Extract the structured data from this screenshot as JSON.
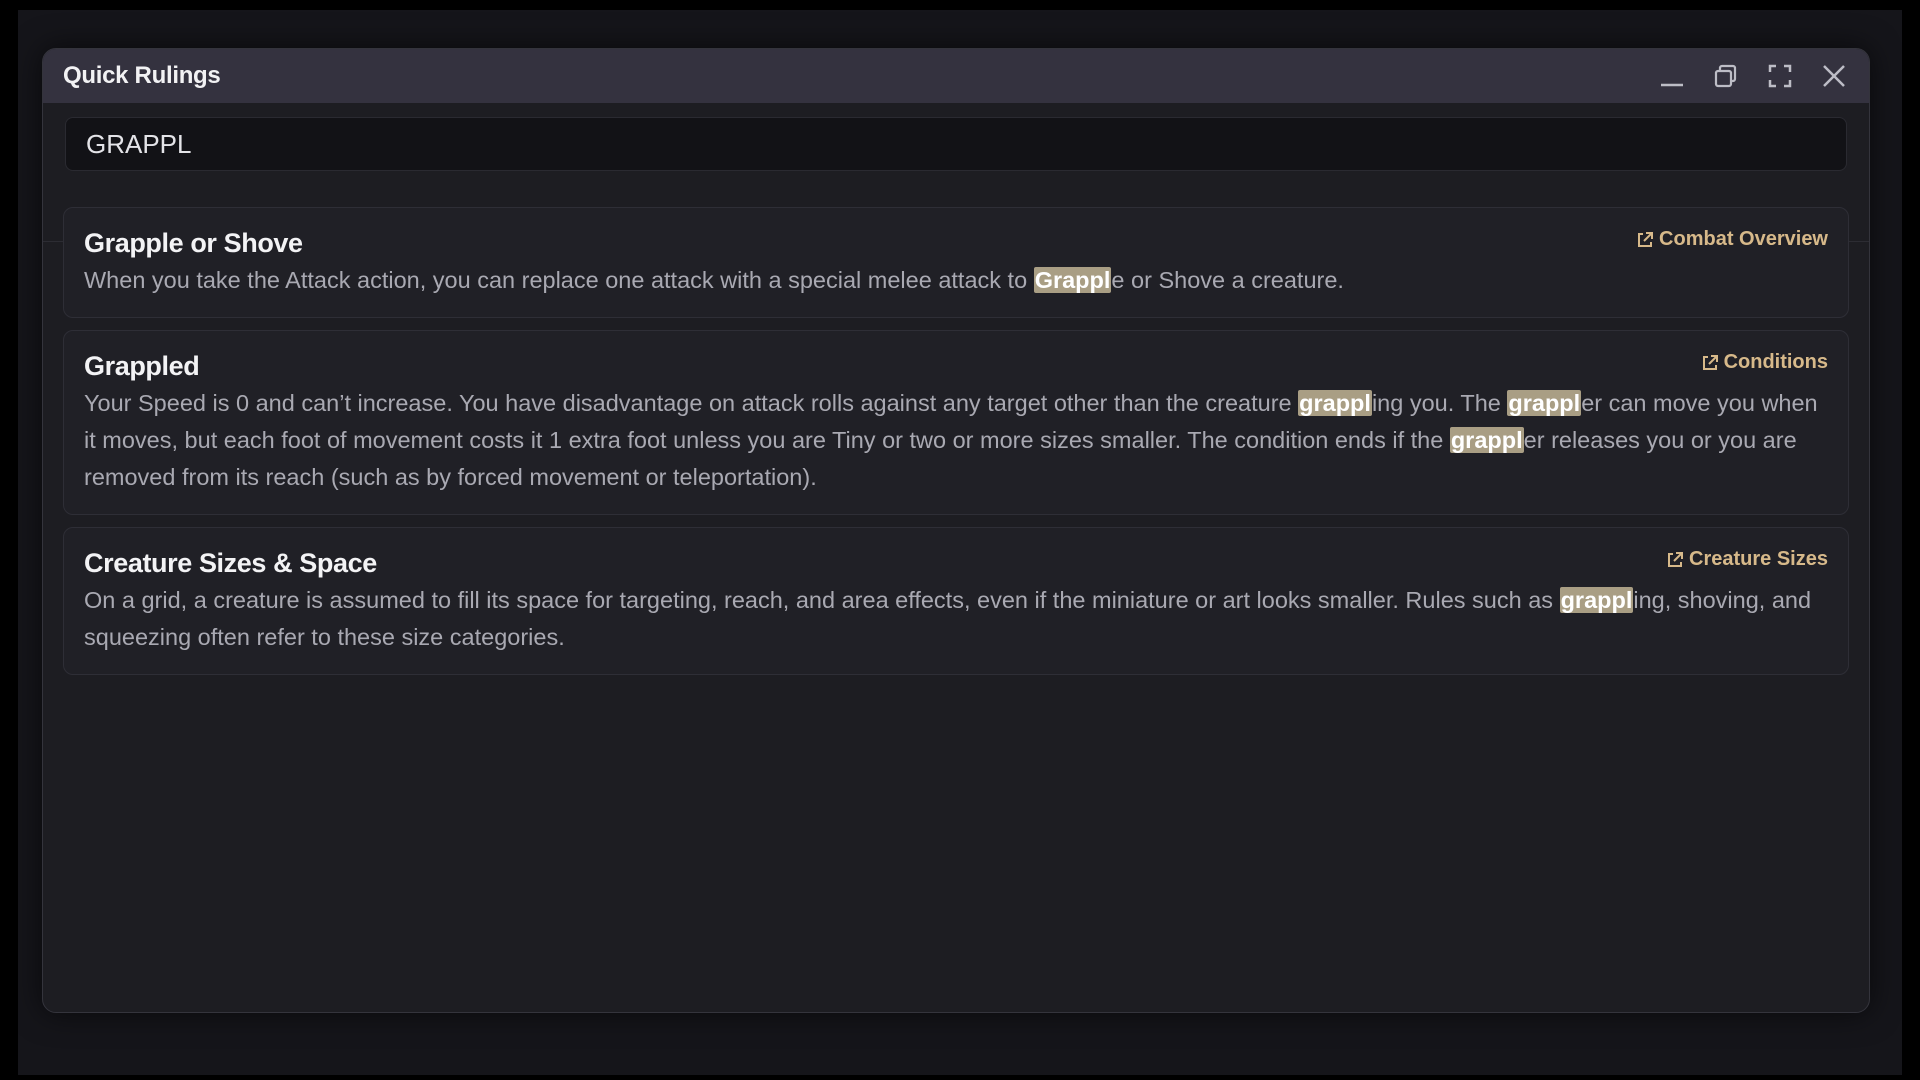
{
  "window": {
    "title": "Quick Rulings",
    "controls": [
      "minimize-icon",
      "restore-icon",
      "fullscreen-icon",
      "close-icon"
    ]
  },
  "search": {
    "value": "GRAPPL",
    "placeholder": ""
  },
  "colors": {
    "titlebar": "#34323f",
    "window_bg": "#1d1d22",
    "card_bg": "#202026",
    "link_accent": "#d7b98a",
    "highlight": "#a99e84",
    "body_text": "#a9a9b2"
  },
  "results": [
    {
      "title": "Grapple or Shove",
      "link_icon": "external-link-icon",
      "link_label": "Combat Overview",
      "segments": [
        {
          "text": "When you take the Attack action, you can replace one attack with a special melee attack to "
        },
        {
          "text": "Grappl",
          "hl": true
        },
        {
          "text": "e or Shove a creature."
        }
      ]
    },
    {
      "title": "Grappled",
      "link_icon": "external-link-icon",
      "link_label": "Conditions",
      "segments": [
        {
          "text": "Your Speed is 0 and can’t increase. You have disadvantage on attack rolls against any target other than the creature "
        },
        {
          "text": "grappl",
          "hl": true
        },
        {
          "text": "ing you. The "
        },
        {
          "text": "grappl",
          "hl": true
        },
        {
          "text": "er can move you when it moves, but each foot of movement costs it 1 extra foot unless you are Tiny or two or more sizes smaller. The condition ends if the "
        },
        {
          "text": "grappl",
          "hl": true
        },
        {
          "text": "er releases you or you are removed from its reach (such as by forced movement or teleportation)."
        }
      ]
    },
    {
      "title": "Creature Sizes & Space",
      "link_icon": "external-link-icon",
      "link_label": "Creature Sizes",
      "segments": [
        {
          "text": "On a grid, a creature is assumed to fill its space for targeting, reach, and area effects, even if the miniature or art looks smaller. Rules such as "
        },
        {
          "text": "grappl",
          "hl": true
        },
        {
          "text": "ing, shoving, and squeezing often refer to these size categories."
        }
      ]
    }
  ]
}
